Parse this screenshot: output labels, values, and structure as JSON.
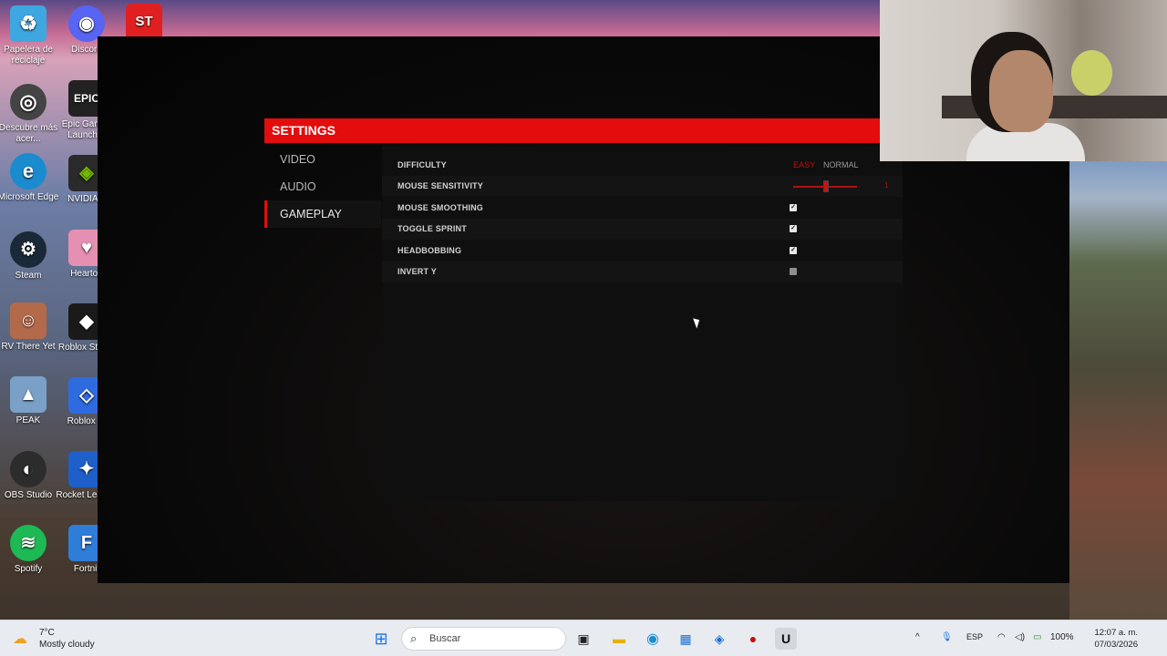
{
  "desktop": {
    "icons": [
      {
        "label": "Papelera de reciclaje",
        "icon": "recycle-bin-icon",
        "color": "#3fa7e0",
        "glyph": "♻"
      },
      {
        "label": "Discord",
        "icon": "discord-icon",
        "color": "#5865f2",
        "glyph": "◉"
      },
      {
        "label": "ST",
        "icon": "st-app-icon",
        "color": "#e02020",
        "glyph": "ST"
      },
      {
        "label": "Descubre más acer...",
        "icon": "discover-icon",
        "color": "#444444",
        "glyph": "◎"
      },
      {
        "label": "Epic Games Launcher",
        "icon": "epic-games-icon",
        "color": "#222222",
        "glyph": "EPIC"
      },
      {
        "label": "Microsoft Edge",
        "icon": "edge-icon",
        "color": "#1b8bd0",
        "glyph": "e"
      },
      {
        "label": "NVIDIA A",
        "icon": "nvidia-icon",
        "color": "#2a2a2a",
        "glyph": "◈"
      },
      {
        "label": "Steam",
        "icon": "steam-icon",
        "color": "#1b2838",
        "glyph": "⚙"
      },
      {
        "label": "Heartop",
        "icon": "heartopia-icon",
        "color": "#e58fb2",
        "glyph": "♥"
      },
      {
        "label": "RV There Yet",
        "icon": "rv-there-yet-icon",
        "color": "#b36a4a",
        "glyph": "☺"
      },
      {
        "label": "Roblox Studio",
        "icon": "roblox-studio-icon",
        "color": "#1a1a1a",
        "glyph": "◆"
      },
      {
        "label": "PEAK",
        "icon": "peak-icon",
        "color": "#7aa0c8",
        "glyph": "▲"
      },
      {
        "label": "Roblox Pl",
        "icon": "roblox-player-icon",
        "color": "#2f6be0",
        "glyph": "◇"
      },
      {
        "label": "OBS Studio",
        "icon": "obs-icon",
        "color": "#2c2c2c",
        "glyph": "◐"
      },
      {
        "label": "Rocket League",
        "icon": "rocket-league-icon",
        "color": "#1e5fc9",
        "glyph": "✦"
      },
      {
        "label": "Spotify",
        "icon": "spotify-icon",
        "color": "#1db954",
        "glyph": "≋"
      },
      {
        "label": "Fortnit",
        "icon": "fortnite-icon",
        "color": "#2e7dd9",
        "glyph": "F"
      }
    ]
  },
  "game": {
    "title": "SETTINGS",
    "menu": [
      {
        "label": "VIDEO",
        "active": false
      },
      {
        "label": "AUDIO",
        "active": false
      },
      {
        "label": "GAMEPLAY",
        "active": true
      }
    ],
    "settings": {
      "difficulty": {
        "label": "DIFFICULTY",
        "options": [
          "EASY",
          "NORMAL"
        ],
        "selected": "EASY"
      },
      "mouse_sensitivity": {
        "label": "MOUSE SENSITIVITY",
        "value": "1",
        "level": 0.5
      },
      "mouse_smoothing": {
        "label": "MOUSE SMOOTHING",
        "checked": true
      },
      "toggle_sprint": {
        "label": "TOGGLE SPRINT",
        "checked": true
      },
      "headbobbing": {
        "label": "HEADBOBBING",
        "checked": true
      },
      "invert_y": {
        "label": "INVERT Y",
        "checked": false
      }
    },
    "colors": {
      "accent": "#e30d0d"
    }
  },
  "taskbar": {
    "weather": {
      "temp": "7°C",
      "condition": "Mostly cloudy"
    },
    "search_placeholder": "Buscar",
    "apps": [
      "start-icon",
      "search-icon",
      "task-view-icon",
      "file-explorer-icon",
      "edge-icon",
      "store-icon",
      "outlook-icon",
      "recorder-icon",
      "unreal-engine-icon"
    ],
    "tray": {
      "language": "ESP",
      "battery": "100%"
    },
    "clock": {
      "time": "12:07 a. m.",
      "date": "07/03/2026"
    }
  }
}
